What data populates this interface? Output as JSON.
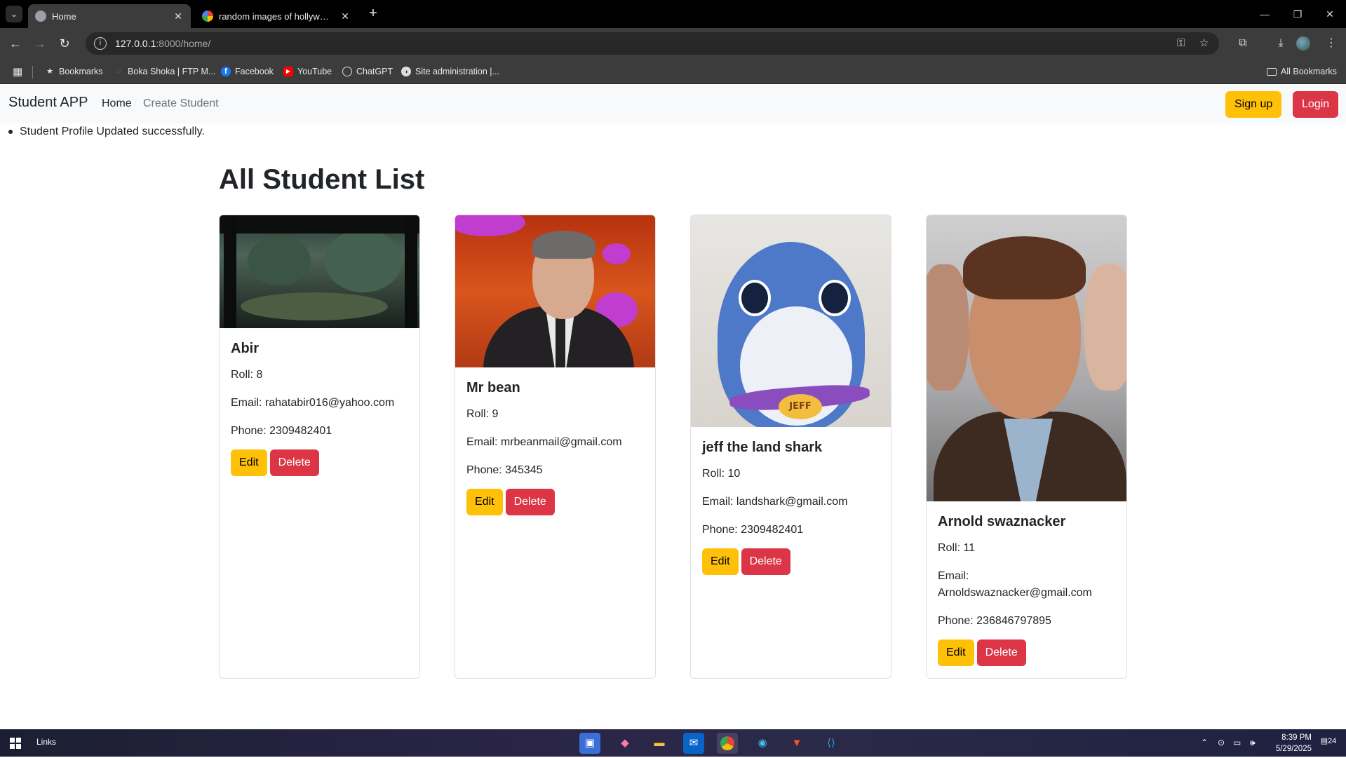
{
  "browser": {
    "tabs": [
      {
        "label": "Home",
        "active": true,
        "favicon": "globe-icon"
      },
      {
        "label": "random images of hollywood a",
        "active": false,
        "favicon": "google-icon"
      }
    ],
    "url_host": "127.0.0.1",
    "url_path": ":8000/home/",
    "bookmarks": [
      {
        "label": "Bookmarks",
        "icon": "star-icon"
      },
      {
        "label": "Boka Shoka | FTP M...",
        "icon": "ftp-icon"
      },
      {
        "label": "Facebook",
        "icon": "facebook-icon"
      },
      {
        "label": "YouTube",
        "icon": "youtube-icon"
      },
      {
        "label": "ChatGPT",
        "icon": "chatgpt-icon"
      },
      {
        "label": "Site administration |...",
        "icon": "django-icon"
      }
    ],
    "all_bookmarks": "All Bookmarks"
  },
  "navbar": {
    "brand": "Student APP",
    "links": [
      "Home",
      "Create Student"
    ],
    "signup": "Sign up",
    "login": "Login"
  },
  "flash_message": "Student Profile Updated successfully.",
  "heading": "All Student List",
  "students": [
    {
      "name": "Abir",
      "roll": "Roll: 8",
      "email": "Email: rahatabir016@yahoo.com",
      "phone": "Phone: 2309482401",
      "image": "forest-scene-photo"
    },
    {
      "name": "Mr bean",
      "roll": "Roll: 9",
      "email": "Email: mrbeanmail@gmail.com",
      "phone": "Phone: 345345",
      "image": "man-in-suit-photo"
    },
    {
      "name": "jeff the land shark",
      "roll": "Roll: 10",
      "email": "Email: landshark@gmail.com",
      "phone": "Phone: 2309482401",
      "image": "cartoon-shark-illustration"
    },
    {
      "name": "Arnold swaznacker",
      "roll": "Roll: 11",
      "email_line1": "Email:",
      "email_line2": "Arnoldswaznacker@gmail.com",
      "phone": "Phone: 236846797895",
      "image": "man-portrait-photo"
    }
  ],
  "buttons": {
    "edit": "Edit",
    "delete": "Delete"
  },
  "shark_tag": "JEFF",
  "taskbar": {
    "links": "Links",
    "time": "8:39 PM",
    "date": "5/29/2025",
    "notifications": "24"
  },
  "colors": {
    "warning": "#ffc107",
    "danger": "#dc3545",
    "navbar_bg": "#f8f9fa"
  }
}
